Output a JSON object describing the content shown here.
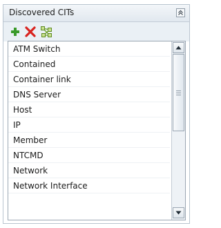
{
  "panel": {
    "title": "Discovered CITs",
    "collapse_icon": "double-chevron-up-icon"
  },
  "toolbar": {
    "buttons": [
      {
        "icon": "plus-icon",
        "color": "#3a9a2a"
      },
      {
        "icon": "delete-x-icon",
        "color": "#d9231f"
      },
      {
        "icon": "ci-type-graph-icon",
        "color": "#6ea02a"
      }
    ]
  },
  "list": {
    "items": [
      "ATM Switch",
      "Contained",
      "Container link",
      "DNS Server",
      "Host",
      "IP",
      "Member",
      "NTCMD",
      "Network",
      "Network Interface"
    ]
  },
  "scrollbar": {
    "up_icon": "arrow-up-icon",
    "down_icon": "arrow-down-icon"
  },
  "colors": {
    "header_bg": "#e1e8ef",
    "toolbar_bg": "#eaf0f5",
    "border": "#b9c4cf"
  }
}
